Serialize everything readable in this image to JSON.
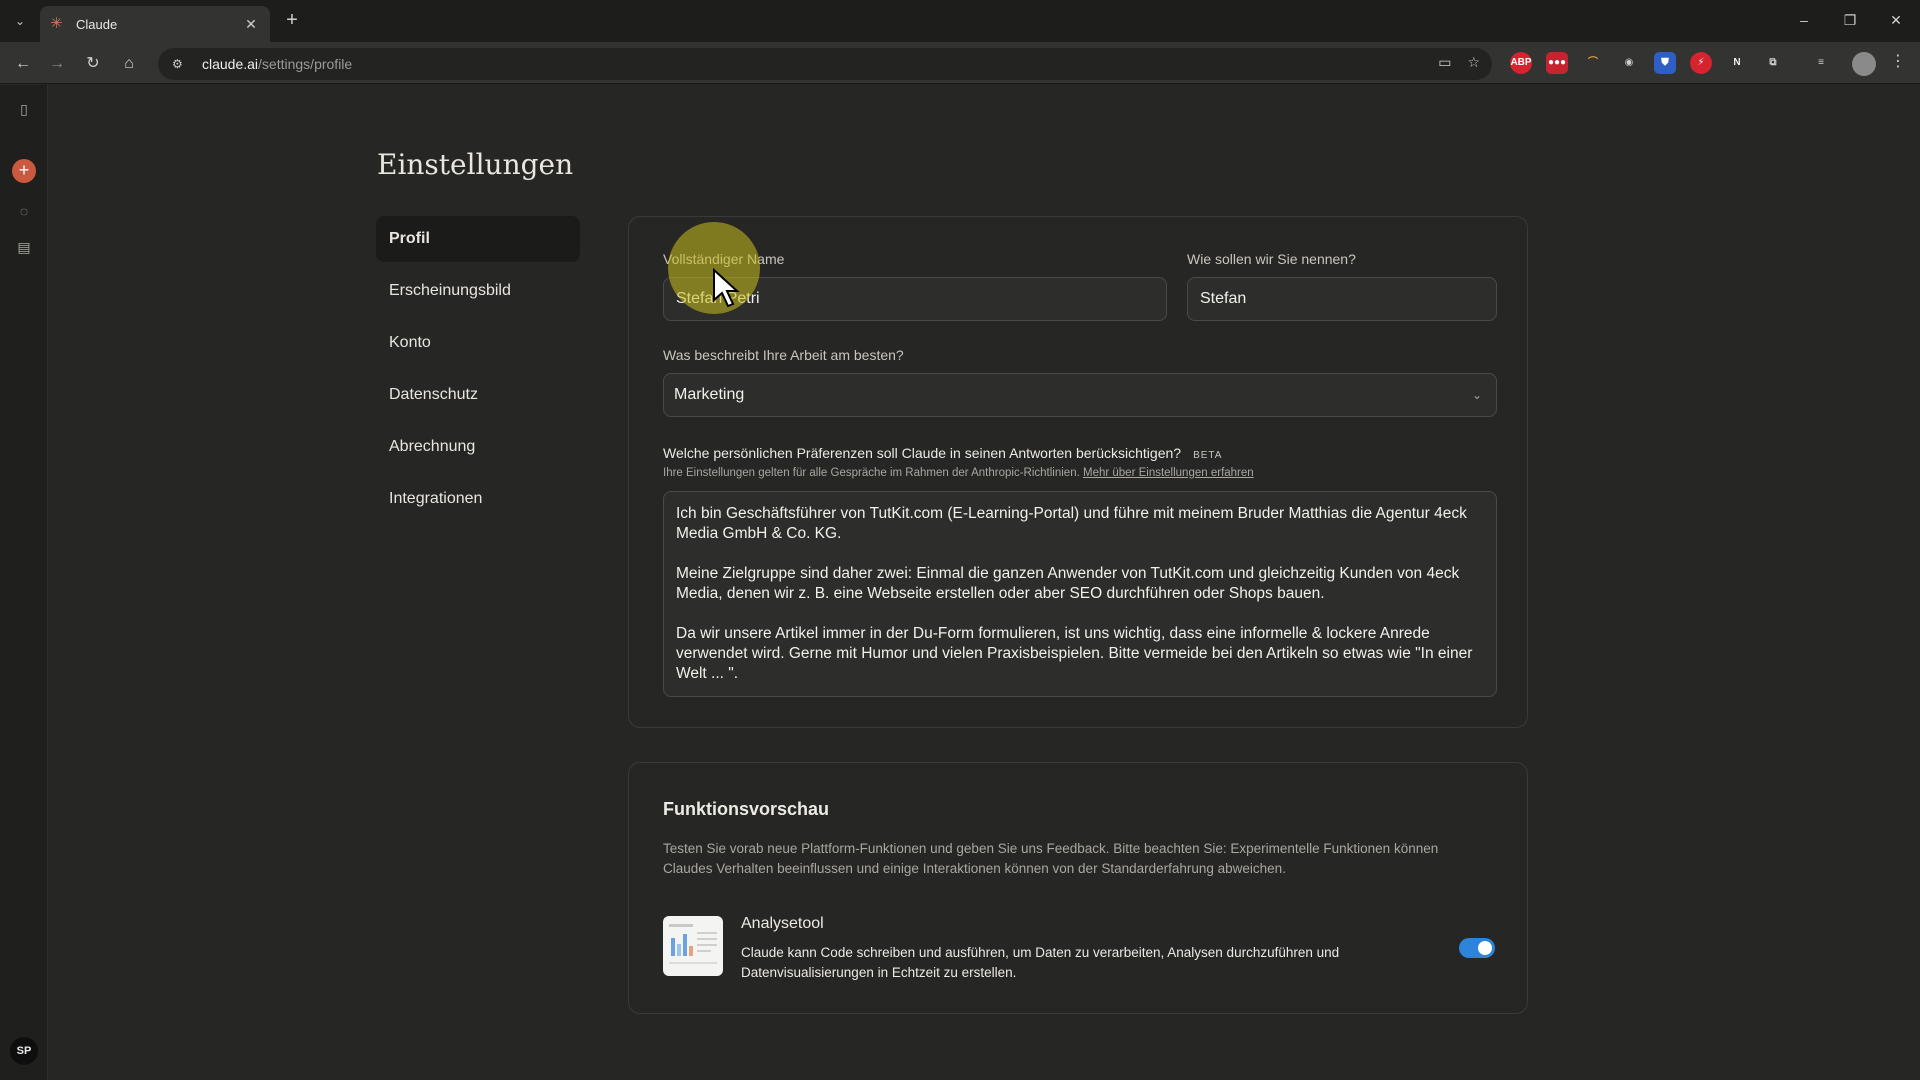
{
  "browser": {
    "tab_title": "Claude",
    "url_host": "claude.ai",
    "url_path": "/settings/profile",
    "extensions": [
      "ABP",
      "●●●",
      "N"
    ]
  },
  "rail": {
    "avatar_initials": "SP"
  },
  "page": {
    "title": "Einstellungen"
  },
  "settings_nav": {
    "items": [
      {
        "label": "Profil",
        "active": true
      },
      {
        "label": "Erscheinungsbild"
      },
      {
        "label": "Konto"
      },
      {
        "label": "Datenschutz"
      },
      {
        "label": "Abrechnung"
      },
      {
        "label": "Integrationen"
      }
    ]
  },
  "profile": {
    "full_name_label": "Vollständiger Name",
    "full_name_value": "Stefan Petri",
    "nickname_label": "Wie sollen wir Sie nennen?",
    "nickname_value": "Stefan",
    "work_label": "Was beschreibt Ihre Arbeit am besten?",
    "work_value": "Marketing",
    "pref_question": "Welche persönlichen Präferenzen soll Claude in seinen Antworten berücksichtigen?",
    "beta_badge": "BETA",
    "pref_hint": "Ihre Einstellungen gelten für alle Gespräche im Rahmen der Anthropic-Richtlinien.",
    "pref_hint_link": "Mehr über Einstellungen erfahren",
    "preferences": [
      "Ich bin Geschäftsführer von TutKit.com (E-Learning-Portal) und führe mit meinem Bruder Matthias die Agentur 4eck Media GmbH & Co. KG.",
      "Meine Zielgruppe sind daher zwei: Einmal die ganzen Anwender von TutKit.com  und gleichzeitig Kunden von 4eck Media, denen wir z. B. eine Webseite erstellen oder aber SEO durchführen oder Shops bauen.",
      "Da wir unsere Artikel immer in der Du-Form formulieren, ist uns wichtig, dass eine informelle & lockere Anrede verwendet wird. Gerne mit Humor und vielen Praxisbeispielen. Bitte vermeide bei den Artikeln so etwas wie \"In einer Welt ... \"."
    ]
  },
  "feature_preview": {
    "title": "Funktionsvorschau",
    "description": "Testen Sie vorab neue Plattform-Funktionen und geben Sie uns Feedback. Bitte beachten Sie: Experimentelle Funktionen können Claudes Verhalten beeinflussen und einige Interaktionen können von der Standarderfahrung abweichen.",
    "feature_name": "Analysetool",
    "feature_desc": "Claude kann Code schreiben und ausführen, um Daten zu verarbeiten, Analysen durchzuführen und Datenvisualisierungen in Echtzeit zu erstellen.",
    "enabled": true
  },
  "colors": {
    "accent": "#c9593f",
    "toggle_on": "#2c84db",
    "background": "#262624"
  }
}
